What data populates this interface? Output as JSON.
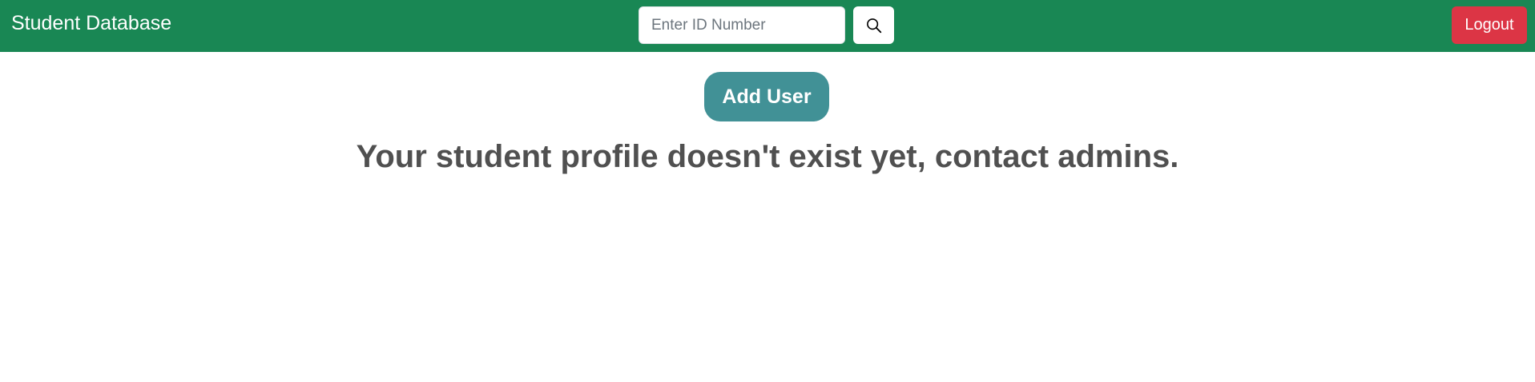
{
  "navbar": {
    "brand": "Student Database",
    "background_color": "#198754",
    "search": {
      "placeholder": "Enter ID Number",
      "value": "",
      "button_icon": "search-icon"
    },
    "logout_label": "Logout",
    "logout_color": "#dc3545"
  },
  "main": {
    "add_user_label": "Add User",
    "add_user_color": "#419196",
    "message": "Your student profile doesn't exist yet, contact admins."
  }
}
